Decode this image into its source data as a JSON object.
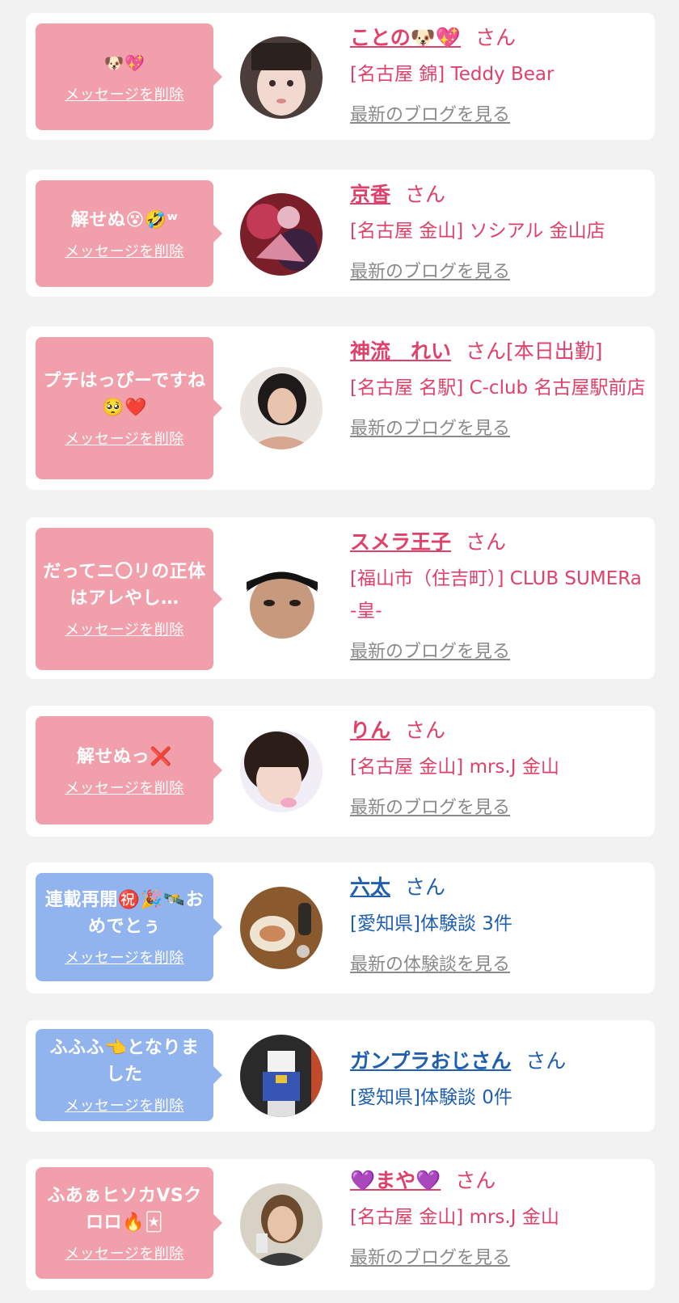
{
  "items": [
    {
      "message": "🐶💖",
      "delete_label": "メッセージを削除",
      "name": "ことの🐶💖",
      "suffix": "さん",
      "shop": "[名古屋 錦] Teddy Bear",
      "link": "最新のブログを見る",
      "type": "girl"
    },
    {
      "message": "解せぬ😵🤣ʷ",
      "delete_label": "メッセージを削除",
      "name": "京香",
      "suffix": "さん",
      "shop": "[名古屋 金山] ソシアル 金山店",
      "link": "最新のブログを見る",
      "type": "girl"
    },
    {
      "message": "プチはっぴーですね🥺❤️",
      "delete_label": "メッセージを削除",
      "name": "神流　れい",
      "suffix": "さん[本日出勤]",
      "shop": "[名古屋 名駅] C-club 名古屋駅前店",
      "link": "最新のブログを見る",
      "type": "girl"
    },
    {
      "message": "だってニ〇リの正体はアレやし…",
      "delete_label": "メッセージを削除",
      "name": "スメラ王子",
      "suffix": "さん",
      "shop": "[福山市（住吉町）] CLUB SUMERa -皇-",
      "link": "最新のブログを見る",
      "type": "girl"
    },
    {
      "message": "解せぬっ❌",
      "delete_label": "メッセージを削除",
      "name": "りん",
      "suffix": "さん",
      "shop": "[名古屋 金山] mrs.J 金山",
      "link": "最新のブログを見る",
      "type": "girl"
    },
    {
      "message": "連載再開㊗️🎉🛰️おめでとぅ",
      "delete_label": "メッセージを削除",
      "name": "六太",
      "suffix": "さん",
      "shop": "[愛知県]体験談 3件",
      "link": "最新の体験談を見る",
      "type": "user"
    },
    {
      "message": "ふふふ👈となりました",
      "delete_label": "メッセージを削除",
      "name": "ガンプラおじさん",
      "suffix": "さん",
      "shop": "[愛知県]体験談 0件",
      "link": "",
      "type": "user"
    },
    {
      "message": "ふあぁヒソカVSクロロ🔥🃏",
      "delete_label": "メッセージを削除",
      "name": "💜まや💜",
      "suffix": "さん",
      "shop": "[名古屋 金山] mrs.J 金山",
      "link": "最新のブログを見る",
      "type": "girl"
    }
  ],
  "colors": {
    "girl_accent": "#e0416a",
    "user_accent": "#1f5fae",
    "pink_bubble": "#f1a0ab",
    "blue_bubble": "#92b4ee",
    "link_gray": "#8a8a8a",
    "background": "#f2f2f2"
  }
}
